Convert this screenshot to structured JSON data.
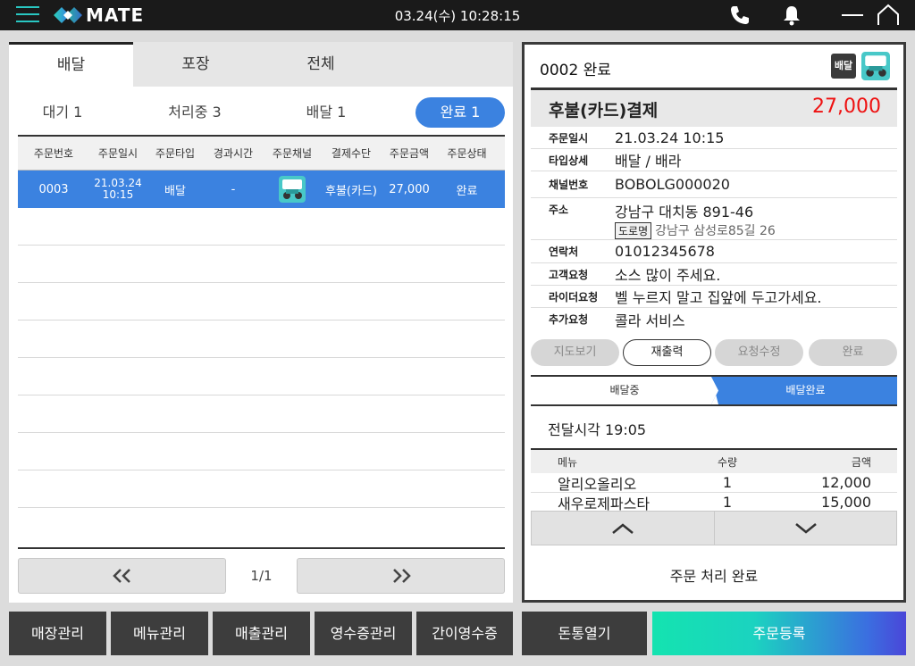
{
  "topbar": {
    "brand": "MATE",
    "datetime": "03.24(수) 10:28:15",
    "icons": [
      "menu-icon",
      "phone-icon",
      "bell-icon",
      "minimize-icon",
      "home-icon"
    ]
  },
  "main_tabs": [
    "배달",
    "포장",
    "전체"
  ],
  "sub_tabs": [
    "대기 1",
    "처리중 3",
    "배달 1",
    "완료 1"
  ],
  "table": {
    "headers": [
      "주문번호",
      "주문일시",
      "주문타입",
      "경과시간",
      "주문채널",
      "결제수단",
      "주문금액",
      "주문상태"
    ],
    "rows": [
      {
        "order_no": "0003",
        "date": "21.03.24",
        "time": "10:15",
        "type": "배달",
        "elapsed": "-",
        "channel_icon": "baemin-logo",
        "payment": "후불(카드)",
        "amount": "27,000",
        "status": "완료"
      }
    ]
  },
  "pager": {
    "page": "1/1",
    "prev_icon": "double-chevron-left-icon",
    "next_icon": "double-chevron-right-icon"
  },
  "detail": {
    "title": "0002 완료",
    "type_badge": "배달",
    "payment_label": "후불(카드)결제",
    "payment_amount": "27,000",
    "info": [
      {
        "key": "주문일시",
        "value": "21.03.24 10:15"
      },
      {
        "key": "타입상세",
        "value": "배달 / 배라"
      },
      {
        "key": "채널번호",
        "value": "BOBOLG000020"
      },
      {
        "key": "주소",
        "value": "강남구 대치동 891-46"
      },
      {
        "key": "연락처",
        "value": "01012345678"
      },
      {
        "key": "고객요청",
        "value": "소스 많이 주세요."
      },
      {
        "key": "라이더요청",
        "value": "벨 누르지 말고 집앞에 두고가세요."
      },
      {
        "key": "추가요청",
        "value": "콜라 서비스"
      }
    ],
    "road_tag": "도로명",
    "road_address": "강남구 삼성로85길 26",
    "actions": [
      "지도보기",
      "재출력",
      "요청수정",
      "완료"
    ],
    "steps": [
      "배달중",
      "배달완료"
    ],
    "delivery_time": "전달시각 19:05",
    "menu_headers": [
      "메뉴",
      "수량",
      "금액"
    ],
    "menu_items": [
      {
        "name": "알리오올리오",
        "qty": "1",
        "price": "12,000"
      },
      {
        "name": "새우로제파스타",
        "qty": "1",
        "price": "15,000"
      }
    ],
    "status_text": "주문 처리 완료"
  },
  "bottom": [
    "매장관리",
    "메뉴관리",
    "매출관리",
    "영수증관리",
    "간이영수증",
    "돈통열기",
    "주문등록"
  ],
  "colors": {
    "accent": "#3b82e0",
    "amount_red": "#e11111",
    "brand_teal": "#29c7c2"
  }
}
